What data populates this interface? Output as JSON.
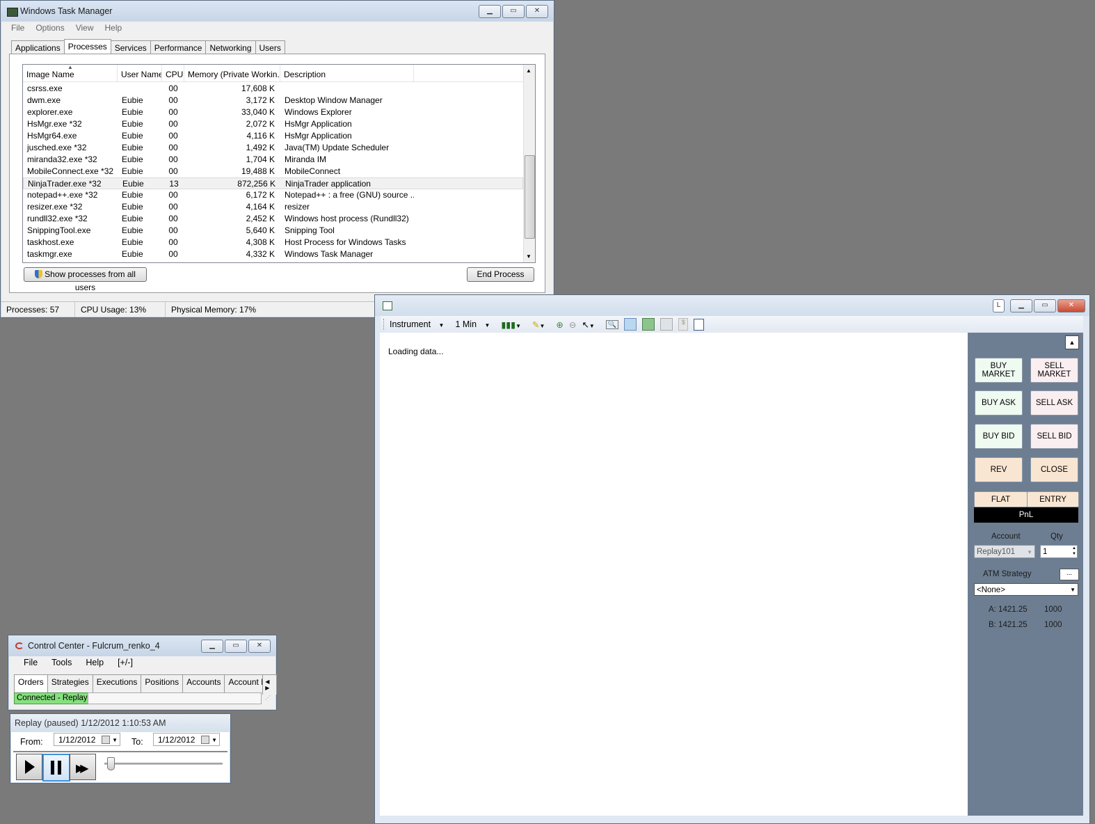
{
  "task_manager": {
    "title": "Windows Task Manager",
    "menu": [
      "File",
      "Options",
      "View",
      "Help"
    ],
    "tabs": [
      "Applications",
      "Processes",
      "Services",
      "Performance",
      "Networking",
      "Users"
    ],
    "columns": [
      "Image Name",
      "User Name",
      "CPU",
      "Memory (Private Workin...",
      "Description"
    ],
    "rows": [
      [
        "csrss.exe",
        "",
        "00",
        "17,608 K",
        ""
      ],
      [
        "dwm.exe",
        "Eubie",
        "00",
        "3,172 K",
        "Desktop Window Manager"
      ],
      [
        "explorer.exe",
        "Eubie",
        "00",
        "33,040 K",
        "Windows Explorer"
      ],
      [
        "HsMgr.exe *32",
        "Eubie",
        "00",
        "2,072 K",
        "HsMgr Application"
      ],
      [
        "HsMgr64.exe",
        "Eubie",
        "00",
        "4,116 K",
        "HsMgr Application"
      ],
      [
        "jusched.exe *32",
        "Eubie",
        "00",
        "1,492 K",
        "Java(TM) Update Scheduler"
      ],
      [
        "miranda32.exe *32",
        "Eubie",
        "00",
        "1,704 K",
        "Miranda IM"
      ],
      [
        "MobileConnect.exe *32",
        "Eubie",
        "00",
        "19,488 K",
        "MobileConnect"
      ],
      [
        "NinjaTrader.exe *32",
        "Eubie",
        "13",
        "872,256 K",
        "NinjaTrader application"
      ],
      [
        "notepad++.exe *32",
        "Eubie",
        "00",
        "6,172 K",
        "Notepad++ : a free (GNU) source ..."
      ],
      [
        "resizer.exe *32",
        "Eubie",
        "00",
        "4,164 K",
        "resizer"
      ],
      [
        "rundll32.exe *32",
        "Eubie",
        "00",
        "2,452 K",
        "Windows host process (Rundll32)"
      ],
      [
        "SnippingTool.exe",
        "Eubie",
        "00",
        "5,640 K",
        "Snipping Tool"
      ],
      [
        "taskhost.exe",
        "Eubie",
        "00",
        "4,308 K",
        "Host Process for Windows Tasks"
      ],
      [
        "taskmgr.exe",
        "Eubie",
        "00",
        "4,332 K",
        "Windows Task Manager"
      ]
    ],
    "show_all_label": "Show processes from all users",
    "end_process_label": "End Process",
    "status": {
      "processes": "Processes: 57",
      "cpu": "CPU Usage: 13%",
      "memory": "Physical Memory: 17%"
    }
  },
  "chart": {
    "instrument_label": "Instrument",
    "interval_label": "1 Min",
    "loading_text": "Loading data...",
    "lock_label": "L",
    "buttons": {
      "buy_market": "BUY MARKET",
      "sell_market": "SELL MARKET",
      "buy_ask": "BUY ASK",
      "sell_ask": "SELL ASK",
      "buy_bid": "BUY BID",
      "sell_bid": "SELL BID",
      "rev": "REV",
      "close": "CLOSE",
      "flat": "FLAT",
      "entry": "ENTRY",
      "pnl": "PnL",
      "atm_more": "..."
    },
    "account_label": "Account",
    "account_value": "Replay101",
    "qty_label": "Qty",
    "qty_value": "1",
    "atm_label": "ATM Strategy",
    "atm_value": "<None>",
    "ask": {
      "label": "A: 1421.25",
      "size": "1000"
    },
    "bid": {
      "label": "B: 1421.25",
      "size": "1000"
    }
  },
  "control_center": {
    "title": "Control Center - Fulcrum_renko_4",
    "menu": [
      "File",
      "Tools",
      "Help",
      "[+/-]"
    ],
    "tabs": [
      "Orders",
      "Strategies",
      "Executions",
      "Positions",
      "Accounts",
      "Account P"
    ],
    "connection_status": "Connected - Replay"
  },
  "replay": {
    "title": "Replay (paused) 1/12/2012 1:10:53 AM",
    "from_label": "From:",
    "from_value": "1/12/2012",
    "to_label": "To:",
    "to_value": "1/12/2012"
  },
  "colors": {
    "accent": "#c7d5e7",
    "side_panel": "#6d7e92",
    "connected": "#86e07e"
  }
}
